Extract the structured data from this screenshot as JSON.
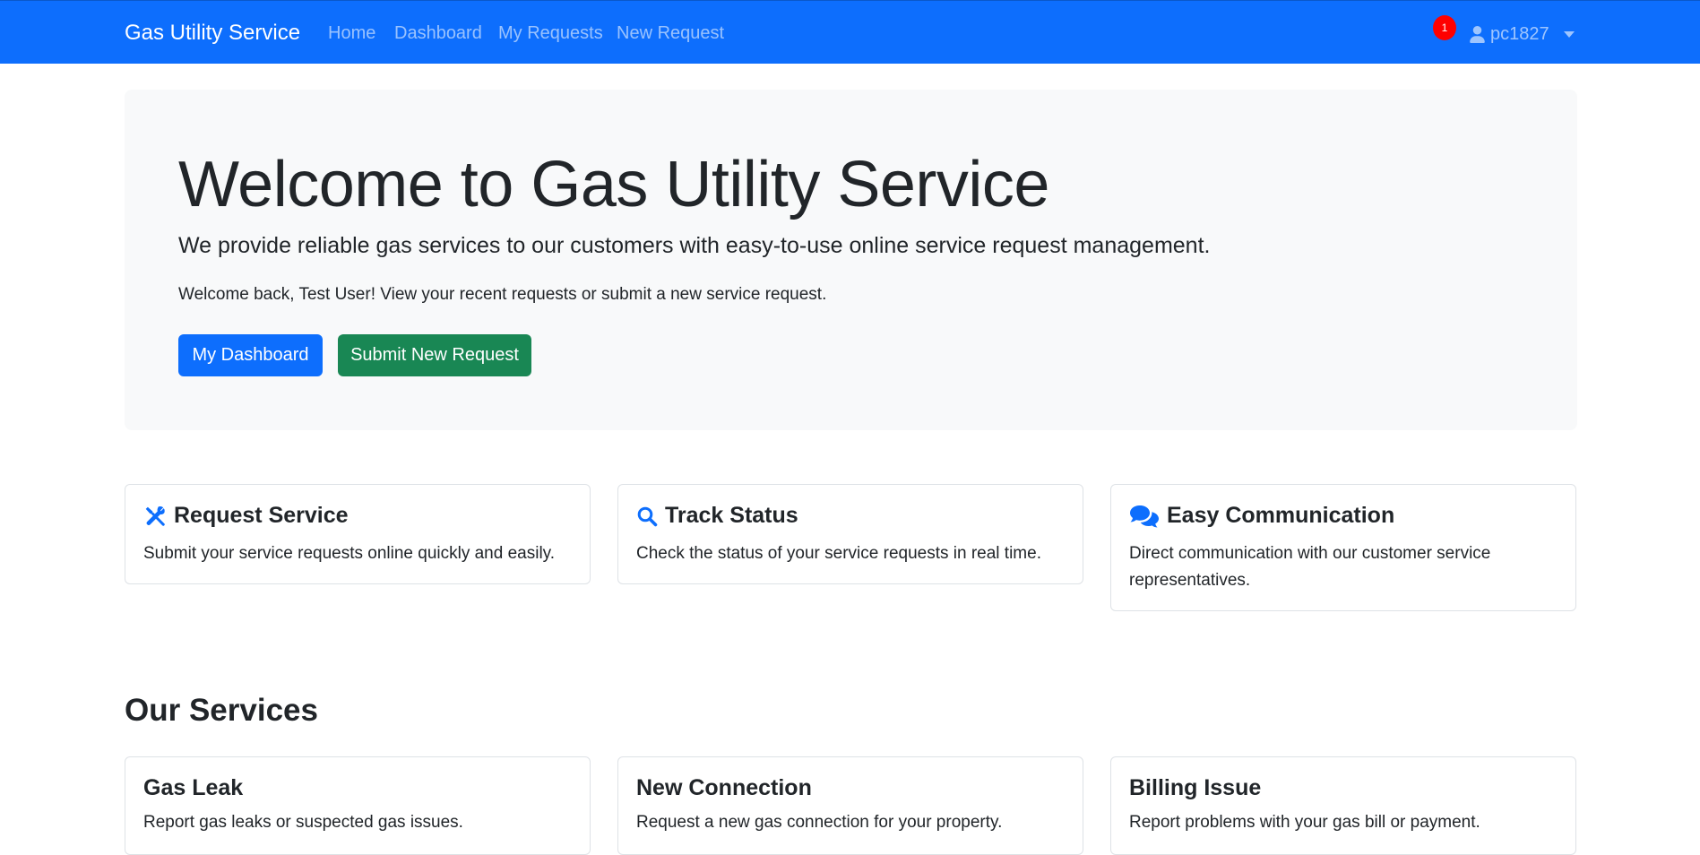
{
  "navbar": {
    "brand": "Gas Utility Service",
    "links": [
      "Home",
      "Dashboard",
      "My Requests",
      "New Request"
    ],
    "notification_count": "1",
    "username": "pc1827",
    "user_icon": "user-icon",
    "bg_color": "#0d6efd"
  },
  "hero": {
    "title": "Welcome to Gas Utility Service",
    "lead": "We provide reliable gas services to our customers with easy-to-use online service request management.",
    "welcome": "Welcome back, Test User! View your recent requests or submit a new service request.",
    "primary_button": "My Dashboard",
    "secondary_button": "Submit New Request"
  },
  "features": [
    {
      "icon": "tools-icon",
      "title": "Request Service",
      "text": "Submit your service requests online quickly and easily."
    },
    {
      "icon": "search-icon",
      "title": "Track Status",
      "text": "Check the status of your service requests in real time."
    },
    {
      "icon": "comments-icon",
      "title": "Easy Communication",
      "text": "Direct communication with our customer service representatives."
    }
  ],
  "services": {
    "heading": "Our Services",
    "items": [
      {
        "title": "Gas Leak",
        "desc": "Report gas leaks or suspected gas issues."
      },
      {
        "title": "New Connection",
        "desc": "Request a new gas connection for your property."
      },
      {
        "title": "Billing Issue",
        "desc": "Report problems with your gas bill or payment."
      }
    ]
  },
  "colors": {
    "primary": "#0d6efd",
    "success": "#198754",
    "badge": "#ff0000",
    "hero_bg": "#f8f9fa"
  }
}
